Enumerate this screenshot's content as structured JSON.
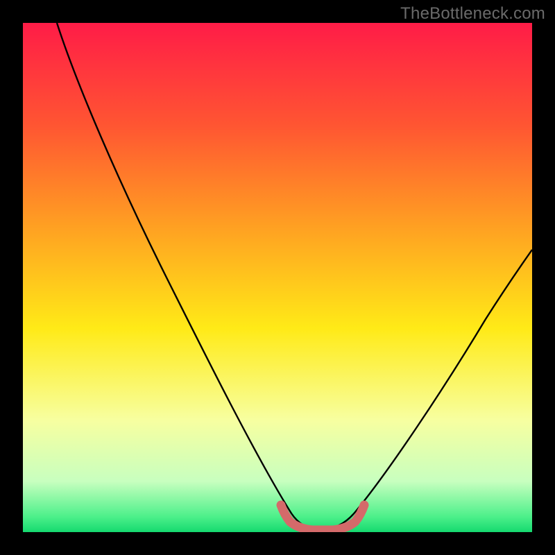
{
  "watermark": "TheBottleneck.com",
  "chart_data": {
    "type": "line",
    "title": "",
    "xlabel": "",
    "ylabel": "",
    "xlim": [
      0,
      100
    ],
    "ylim": [
      0,
      100
    ],
    "background": {
      "type": "vertical-gradient",
      "stops": [
        {
          "pos": 0.0,
          "color": "#ff1c47"
        },
        {
          "pos": 0.2,
          "color": "#ff5532"
        },
        {
          "pos": 0.4,
          "color": "#ffa022"
        },
        {
          "pos": 0.6,
          "color": "#ffea17"
        },
        {
          "pos": 0.78,
          "color": "#f7ffa0"
        },
        {
          "pos": 0.9,
          "color": "#c8ffbf"
        },
        {
          "pos": 0.97,
          "color": "#4cf08a"
        },
        {
          "pos": 1.0,
          "color": "#15d96f"
        }
      ]
    },
    "series": [
      {
        "name": "bottleneck-curve",
        "color": "#000000",
        "points": [
          {
            "x": 7,
            "y": 100
          },
          {
            "x": 15,
            "y": 84
          },
          {
            "x": 23,
            "y": 68
          },
          {
            "x": 31,
            "y": 50
          },
          {
            "x": 39,
            "y": 32
          },
          {
            "x": 47,
            "y": 14
          },
          {
            "x": 51,
            "y": 6
          },
          {
            "x": 55,
            "y": 2
          },
          {
            "x": 60,
            "y": 2
          },
          {
            "x": 65,
            "y": 6
          },
          {
            "x": 73,
            "y": 20
          },
          {
            "x": 83,
            "y": 40
          },
          {
            "x": 93,
            "y": 56
          },
          {
            "x": 100,
            "y": 60
          }
        ]
      },
      {
        "name": "optimal-zone-marker",
        "color": "#d46a6a",
        "points": [
          {
            "x": 50,
            "y": 6
          },
          {
            "x": 51,
            "y": 3
          },
          {
            "x": 53,
            "y": 2
          },
          {
            "x": 57,
            "y": 2
          },
          {
            "x": 60,
            "y": 2
          },
          {
            "x": 63,
            "y": 3
          },
          {
            "x": 65,
            "y": 6
          }
        ]
      }
    ]
  }
}
